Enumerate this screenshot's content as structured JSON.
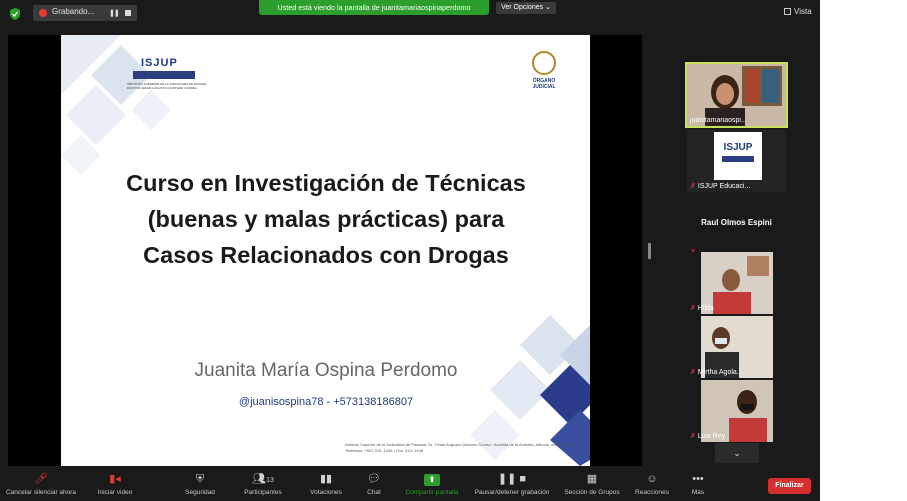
{
  "topbar": {
    "recording_label": "Grabando...",
    "share_banner": "Usted está viendo la pantalla de juanitamariaospinaperdomo",
    "view_options": "Ver Opciones ⌄",
    "view_label": "Vista"
  },
  "slide": {
    "logo_left_text": "ISJUP",
    "logo_left_subtitle": "INSTITUTO SUPERIOR DE LA JUDICATURA DE PANAMÁ · DOCTOR CÉSAR AUGUSTO QUINTERO CORREA",
    "logo_right_text": "ÓRGANO JUDICIAL",
    "title_line1": "Curso en Investigación de Técnicas",
    "title_line2": "(buenas y malas prácticas) para",
    "title_line3": "Casos Relacionados con Drogas",
    "author": "Juanita María Ospina Perdomo",
    "handle": "@juanisospina78 - +573138186807",
    "footer": "Instituto Superior de la Judicatura de Panamá, Dr. César Augusto Quintero Correa · Avenida de la Amistad, Albrook, edificio 865, Teléfonos: +507 315- 1445 • Fax: 315- 1448"
  },
  "participants": [
    {
      "name": "juanitamariaospi...",
      "muted": false,
      "active": true,
      "kind": "video-woman"
    },
    {
      "name": "ISJUP Educaci...",
      "muted": true,
      "active": false,
      "kind": "logo"
    },
    {
      "name": "Raul Olmos Espini",
      "muted": true,
      "active": false,
      "kind": "name-only"
    },
    {
      "name": "Hilda",
      "muted": true,
      "active": false,
      "kind": "video"
    },
    {
      "name": "Mirtha Agola...",
      "muted": true,
      "active": false,
      "kind": "video"
    },
    {
      "name": "Luis Rey",
      "muted": true,
      "active": false,
      "kind": "video"
    }
  ],
  "toolbar": {
    "unmute": "Cancelar silenciar ahora",
    "start_video": "Iniciar video",
    "security": "Seguridad",
    "participants": "Participantes",
    "participants_count": "13",
    "polls": "Votaciones",
    "chat": "Chat",
    "share": "Compartir pantalla",
    "record": "Pausar/detener grabación",
    "breakout": "Sección de Grupos",
    "reactions": "Reacciones",
    "more": "Más",
    "end": "Finalizar"
  },
  "colors": {
    "share_green": "#2c9e2c",
    "active_outline": "#c8e05a",
    "end_red": "#d62f2f",
    "slide_navy": "#1f3a7a"
  }
}
